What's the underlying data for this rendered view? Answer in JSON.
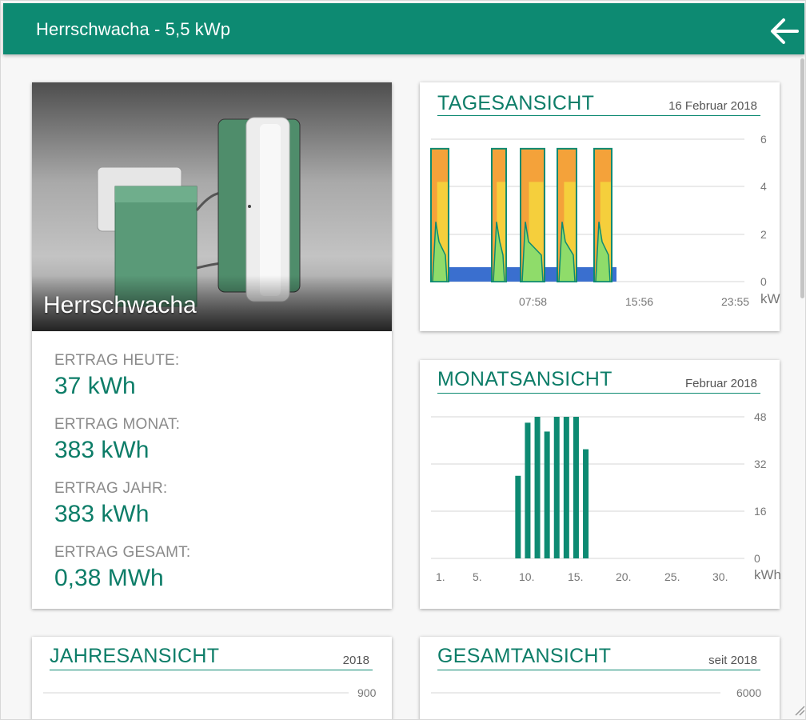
{
  "header": {
    "title": "Herrschwacha - 5,5 kWp",
    "back_icon": "arrow-left-icon"
  },
  "plant": {
    "name": "Herrschwacha",
    "stats": [
      {
        "label": "ERTRAG HEUTE:",
        "value": "37 kWh"
      },
      {
        "label": "ERTRAG MONAT:",
        "value": "383 kWh"
      },
      {
        "label": "ERTRAG JAHR:",
        "value": "383 kWh"
      },
      {
        "label": "ERTRAG GESAMT:",
        "value": "0,38 MWh"
      }
    ]
  },
  "colors": {
    "accent": "#0d8a72",
    "orange": "#f4a23a",
    "yellow": "#f5cf3c",
    "green": "#8fdc6a",
    "blue": "#3a6fcf"
  },
  "day": {
    "title": "TAGESANSICHT",
    "date": "16 Februar 2018",
    "unit": "kW"
  },
  "month": {
    "title": "MONATSANSICHT",
    "date": "Februar 2018",
    "unit": "kWh"
  },
  "year": {
    "title": "JAHRESANSICHT",
    "date": "2018",
    "tick": "900"
  },
  "total": {
    "title": "GESAMTANSICHT",
    "date": "seit 2018",
    "tick": "6000"
  },
  "chart_data": [
    {
      "type": "area",
      "chart": "day",
      "ylim": [
        0,
        6
      ],
      "yticks": [
        "0",
        "2",
        "4",
        "6"
      ],
      "xticks": [
        "07:58",
        "15:56",
        "23:55"
      ],
      "ylabel": "kW",
      "series": [
        {
          "color": "orange",
          "blocks": [
            [
              0.1,
              5.6
            ],
            [
              2.6,
              5.6
            ],
            [
              3.5,
              5.6
            ],
            [
              5.3,
              5.6
            ],
            [
              6.8,
              5.6
            ]
          ]
        }
      ]
    },
    {
      "type": "bar",
      "chart": "month",
      "ylim": [
        0,
        48
      ],
      "yticks": [
        "0",
        "16",
        "32",
        "48"
      ],
      "xticks": [
        "1.",
        "5.",
        "10.",
        "15.",
        "20.",
        "25.",
        "30."
      ],
      "ylabel": "kWh",
      "categories": [
        9,
        10,
        11,
        12,
        13,
        14,
        15,
        16
      ],
      "values": [
        28,
        46,
        48,
        43,
        48,
        48,
        48,
        37
      ]
    }
  ]
}
